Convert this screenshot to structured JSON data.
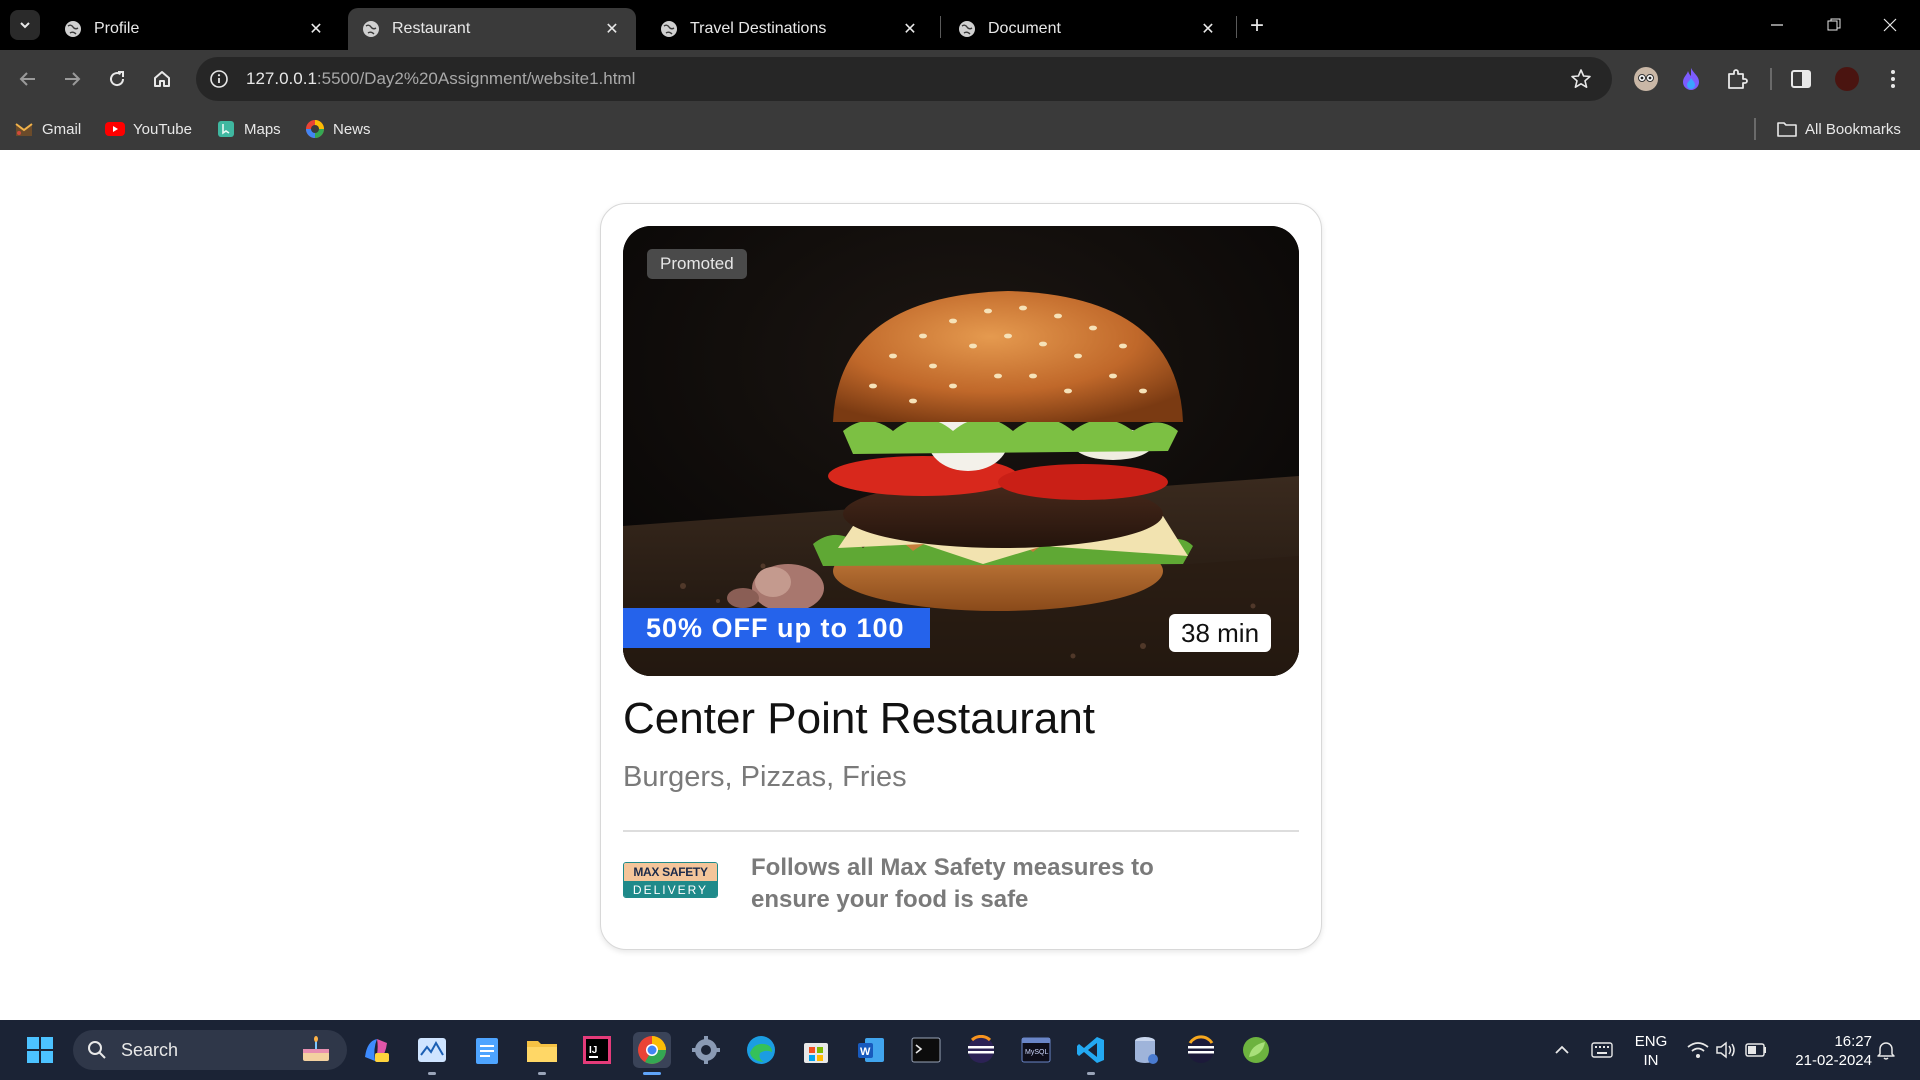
{
  "browser": {
    "tabs": [
      {
        "title": "Profile",
        "active": false
      },
      {
        "title": "Restaurant",
        "active": true
      },
      {
        "title": "Travel Destinations",
        "active": false
      },
      {
        "title": "Document",
        "active": false
      }
    ],
    "url_host": "127.0.0.1",
    "url_rest": ":5500/Day2%20Assignment/website1.html",
    "bookmarks": [
      {
        "label": "Gmail",
        "icon": "gmail-icon"
      },
      {
        "label": "YouTube",
        "icon": "youtube-icon"
      },
      {
        "label": "Maps",
        "icon": "maps-icon"
      },
      {
        "label": "News",
        "icon": "news-icon"
      }
    ],
    "all_bookmarks_label": "All Bookmarks"
  },
  "card": {
    "promoted_label": "Promoted",
    "discount_label": "50% OFF up to 100",
    "eta_label": "38 min",
    "restaurant_name": "Center Point Restaurant",
    "cuisines": "Burgers, Pizzas, Fries",
    "safety_logo_top": "MAX SAFETY",
    "safety_logo_bottom": "DELIVERY",
    "safety_text": "Follows all Max Safety measures to ensure your food is safe"
  },
  "taskbar": {
    "search_label": "Search",
    "language": "ENG",
    "region": "IN",
    "time": "16:27",
    "date": "21-02-2024"
  },
  "colors": {
    "discount_banner": "#2563eb",
    "tab_strip": "#000000",
    "toolbar": "#3a3a3a",
    "taskbar": "#1b2335"
  }
}
